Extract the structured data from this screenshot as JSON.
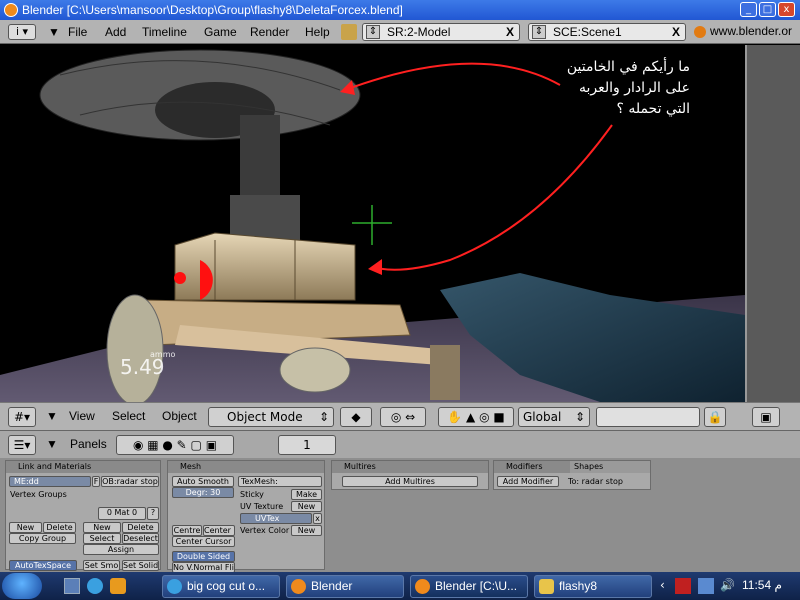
{
  "window": {
    "title": "Blender [C:\\Users\\mansoor\\Desktop\\Group\\flashy8\\DeletaForcex.blend]",
    "controls": [
      "_",
      "□",
      "x"
    ]
  },
  "menubar": {
    "items": [
      "File",
      "Add",
      "Timeline",
      "Game",
      "Render",
      "Help"
    ],
    "screen": "SR:2-Model",
    "scene": "SCE:Scene1",
    "url": "www.blender.or"
  },
  "viewport": {
    "annotation": [
      "ما رأيكم في الخامتين",
      "على الرادار والعربه",
      "التي تحمله ؟"
    ],
    "hud_label": "ammo",
    "hud_value": "5.49"
  },
  "header3d": {
    "menus": [
      "View",
      "Select",
      "Object"
    ],
    "mode": "Object Mode",
    "orientation": "Global"
  },
  "buttons_header": {
    "panels_label": "Panels",
    "frame": "1"
  },
  "panels": {
    "link_materials": {
      "title": "Link and Materials",
      "me_field": "ME:dd",
      "f_label": "F",
      "ob_field": "OB:radar stop",
      "vertex_groups": "Vertex Groups",
      "mat_field": "0 Mat 0",
      "question": "?",
      "new": "New",
      "delete": "Delete",
      "copy_group": "Copy Group",
      "new2": "New",
      "delete2": "Delete",
      "select": "Select",
      "deselect": "Deselect",
      "assign": "Assign",
      "autotexspace": "AutoTexSpace",
      "set_smo": "Set Smo",
      "set_solid": "Set Solid"
    },
    "mesh": {
      "title": "Mesh",
      "auto_smooth": "Auto Smooth",
      "degr": "Degr: 30",
      "texmesh": "TexMesh:",
      "sticky": "Sticky",
      "make": "Make",
      "uv_texture": "UV Texture",
      "new": "New",
      "uvtex": "UVTex",
      "vertex_color": "Vertex Color",
      "new2": "New",
      "centre": "Centre",
      "center_new": "Center Ne",
      "center_cursor": "Center Cursor",
      "double_sided": "Double Sided",
      "no_vnormal": "No V.Normal Fli"
    },
    "multires": {
      "title": "Multires",
      "add": "Add Multires"
    },
    "modifiers": {
      "tab1": "Modifiers",
      "tab2": "Shapes",
      "add": "Add Modifier",
      "to": "To: radar stop"
    }
  },
  "taskbar": {
    "items": [
      "big cog cut o...",
      "Blender",
      "Blender [C:\\U...",
      "flashy8"
    ],
    "clock": "11:54 م"
  }
}
